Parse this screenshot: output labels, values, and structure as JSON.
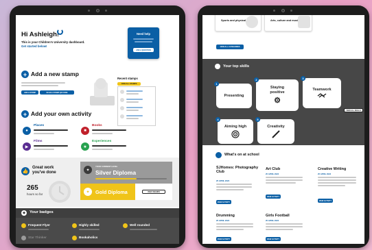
{
  "dashboard": {
    "greeting": "Hi Ashleigh!",
    "subtitle": "This is your Children's University dashboard.",
    "get_started": "Get started below!",
    "help_title": "Need help",
    "help_btn": "ASK A QUESTION",
    "add_stamp_title": "Add a new stamp",
    "add_stamp_btn_1": "ADD A STAMP",
    "add_stamp_btn_2": "SCAN A STAMP QR CODE",
    "recent_title": "Recent stamps",
    "recent_btn": "VIEW ALL STAMPS",
    "add_activity_title": "Add your own activity",
    "categories": [
      {
        "label": "Places",
        "color": "#0b5fa5",
        "icon": "pin-icon"
      },
      {
        "label": "Books",
        "color": "#c0202b",
        "icon": "book-icon"
      },
      {
        "label": "Films",
        "color": "#5a2d91",
        "icon": "film-icon"
      },
      {
        "label": "Experiences",
        "color": "#27a14f",
        "icon": "star-icon"
      }
    ],
    "great_work_1": "Great work",
    "great_work_2": "you've done",
    "hours": "265",
    "hours_label": "hours so far",
    "current_level_label": "YOUR CURRENT LEVEL",
    "current_level": "Silver Diploma",
    "next_level": "Gold Diploma",
    "next_level_btn": "VIEW AWARDS",
    "badges_title": "Your badges",
    "badges": [
      "Frequent Flyer",
      "Highly skilled",
      "Well rounded",
      "Star Thinker",
      "Bookaholics"
    ],
    "colors": {
      "accent": "#0b5fa5",
      "yellow": "#f0c419",
      "silver": "#c7c7c7"
    }
  },
  "school_page": {
    "categories": [
      "Sports and physical",
      "Arts, culture and music"
    ],
    "view_categories_btn": "VIEW ALL CATEGORIES",
    "skills_title": "Your top skills",
    "skills": [
      {
        "label": "Presenting",
        "num": "1",
        "icon": "speech-icon"
      },
      {
        "label": "Staying positive",
        "num": "2",
        "icon": "gear-icon"
      },
      {
        "label": "Teamwork",
        "num": "3",
        "icon": "handshake-icon"
      },
      {
        "label": "Aiming high",
        "num": "4",
        "icon": "target-icon"
      },
      {
        "label": "Creativity",
        "num": "5",
        "icon": "brush-icon"
      }
    ],
    "view_skills_btn": "VIEW ALL SKILLS",
    "school_title": "What's on at school",
    "activities": [
      {
        "title": "SJHomes: Photography Club",
        "date": "25 APRIL 2022",
        "btn": "VIEW ACTIVITY"
      },
      {
        "title": "Art Club",
        "date": "25 APRIL 2022",
        "btn": "VIEW ACTIVITY"
      },
      {
        "title": "Creative Writing",
        "date": "25 APRIL 2022",
        "btn": "VIEW ACTIVITY"
      },
      {
        "title": "Drumming",
        "date": "25 APRIL 2022",
        "btn": "VIEW ACTIVITY"
      },
      {
        "title": "Girls Football",
        "date": "25 APRIL 2022",
        "btn": "VIEW ACTIVITY"
      }
    ]
  }
}
